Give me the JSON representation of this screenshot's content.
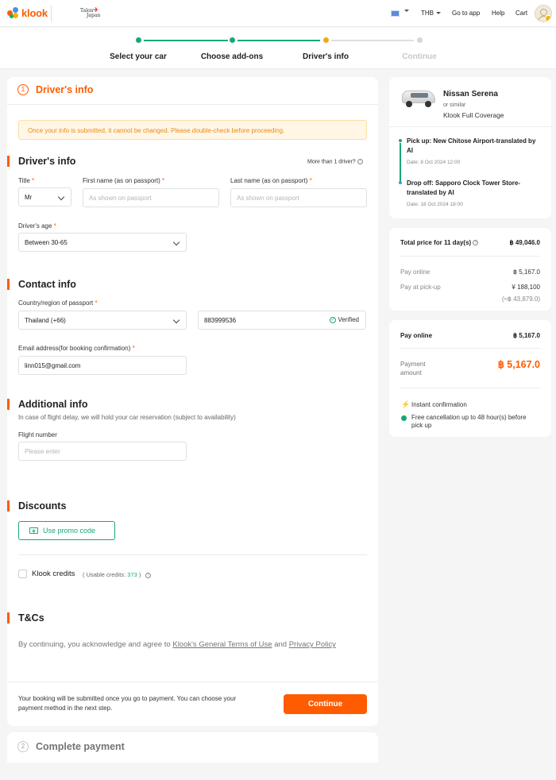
{
  "header": {
    "brand": "klook",
    "partner_line1": "Talon",
    "partner_line2": "Japan",
    "currency": "THB",
    "go_to_app": "Go to app",
    "help": "Help",
    "cart": "Cart"
  },
  "steps": [
    {
      "label": "Select your car",
      "state": "done"
    },
    {
      "label": "Choose add-ons",
      "state": "done"
    },
    {
      "label": "Driver's info",
      "state": "current"
    },
    {
      "label": "Continue",
      "state": "upcoming"
    }
  ],
  "colors": {
    "accent": "#ff5b00",
    "success": "#16a972",
    "current_step": "#f0a818",
    "pending": "#d6d6d6"
  },
  "main": {
    "step_number": "1",
    "step_title": "Driver's info",
    "warning": "Once your info is submitted, it cannot be changed. Please double-check before proceeding.",
    "drivers_info": {
      "title": "Driver's info",
      "more_than_one": "More than 1 driver?",
      "title_label": "Title",
      "title_value": "Mr",
      "first_name_label": "First name (as on passport)",
      "first_name_placeholder": "As shown on passport",
      "last_name_label": "Last name (as on passport)",
      "last_name_placeholder": "As shown on passport",
      "age_label": "Driver's age",
      "age_value": "Between 30-65",
      "required_mark": "*"
    },
    "contact_info": {
      "title": "Contact info",
      "country_label": "Country/region of passport",
      "country_value": "Thailand (+66)",
      "phone_value": "883999536",
      "verified": "Verified",
      "email_label": "Email address(for booking confirmation)",
      "email_value": "linn015@gmail.com"
    },
    "additional_info": {
      "title": "Additional info",
      "description": "In case of flight delay, we will hold your car reservation (subject to availability)",
      "flight_label": "Flight number",
      "flight_placeholder": "Please enter"
    },
    "discounts": {
      "title": "Discounts",
      "promo_button": "Use promo code",
      "credits_label": "Klook credits",
      "usable_prefix": "( Usable credits:",
      "usable_amount": "373",
      "usable_suffix": ")"
    },
    "tcs": {
      "title": "T&Cs",
      "text_before": "By continuing, you acknowledge and agree to ",
      "link1": "Klook's General Terms of Use",
      "text_mid": " and ",
      "link2": "Privacy Policy"
    },
    "submit_note": "Your booking will be submitted once you go to payment. You can choose your payment method in the next step.",
    "continue_button": "Continue"
  },
  "payment_step": {
    "step_number": "2",
    "title": "Complete payment"
  },
  "summary": {
    "car_name": "Nissan Serena",
    "car_similar": "or similar",
    "coverage": "Klook Full Coverage",
    "pickup_title": "Pick up: New Chitose Airport-translated by AI",
    "pickup_date": "Date: 8 Oct 2024 12:00",
    "dropoff_title": "Drop off: Sapporo Clock Tower Store-translated by AI",
    "dropoff_date": "Date: 18 Oct 2024 18:00"
  },
  "price": {
    "total_label": "Total price for 11 day(s)",
    "total_value": "฿ 49,046.0",
    "pay_online_label": "Pay online",
    "pay_online_value": "฿ 5,167.0",
    "pay_pickup_label": "Pay at pick-up",
    "pay_pickup_value": "¥ 188,100",
    "pay_pickup_approx": "(≈฿ 43,879.0)"
  },
  "payment": {
    "pay_online_label": "Pay online",
    "pay_online_value": "฿ 5,167.0",
    "amount_label": "Payment amount",
    "amount_value": "฿ 5,167.0",
    "instant": "Instant confirmation",
    "free_cancel": "Free cancellation up to 48 hour(s) before pick up"
  }
}
